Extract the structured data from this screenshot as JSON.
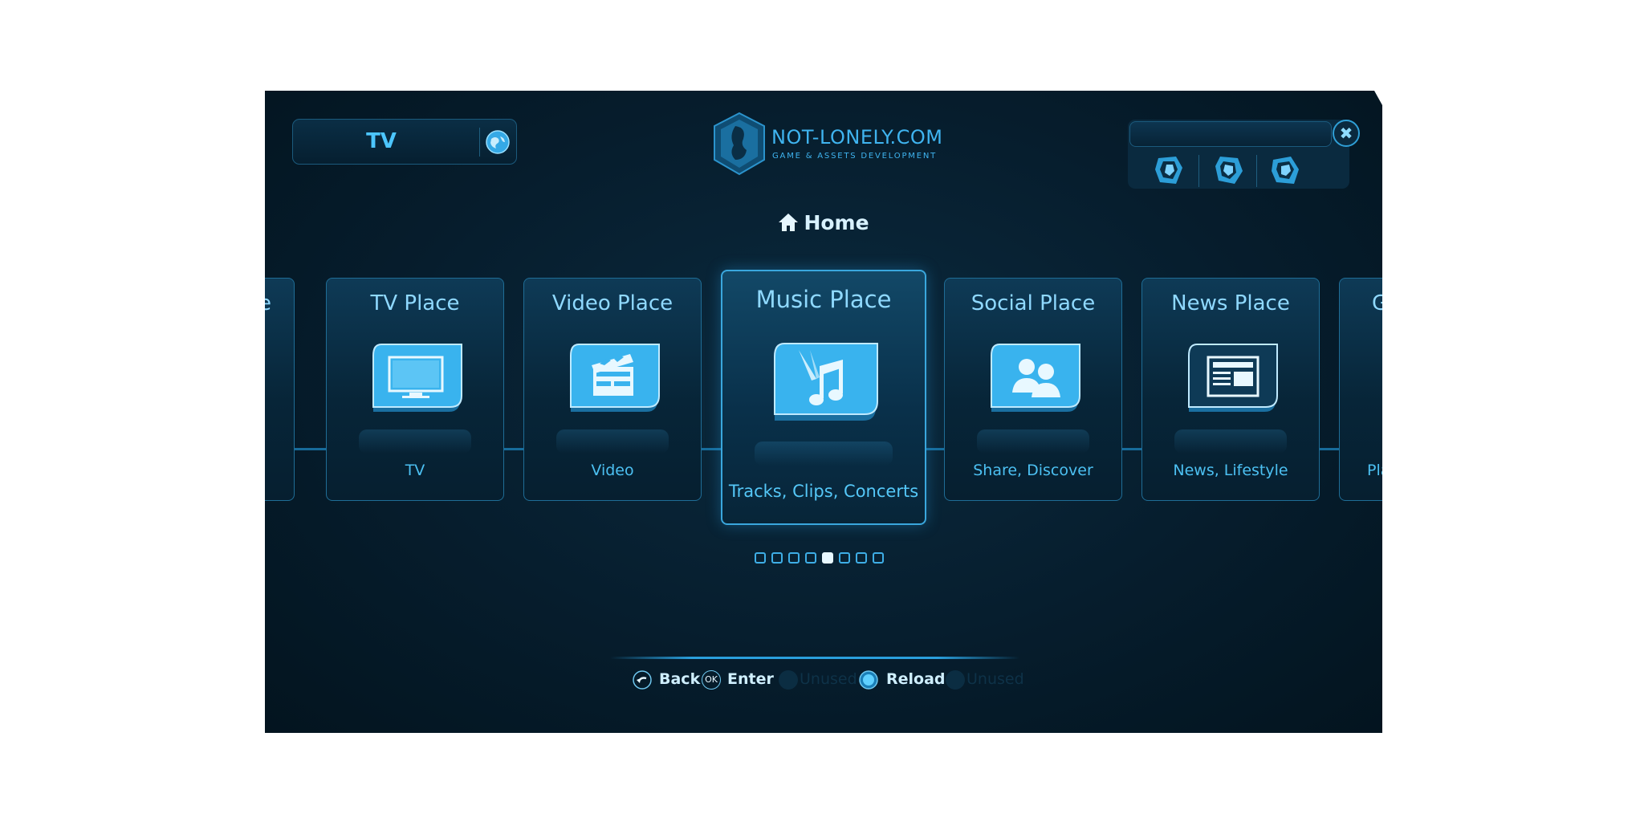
{
  "header": {
    "channel_label": "TV",
    "logo_title": "NOT-LONELY.COM",
    "logo_subtitle": "GAME & ASSETS DEVELOPMENT",
    "close_symbol": "✖"
  },
  "nav": {
    "home_label": "Home"
  },
  "carousel": {
    "cards": [
      {
        "title": "te",
        "subtitle": "",
        "icon": "partial-icon"
      },
      {
        "title": "TV Place",
        "subtitle": "TV",
        "icon": "tv-icon"
      },
      {
        "title": "Video Place",
        "subtitle": "Video",
        "icon": "clapperboard-icon"
      },
      {
        "title": "Music Place",
        "subtitle": "Tracks, Clips, Concerts",
        "icon": "music-note-icon",
        "active": true
      },
      {
        "title": "Social Place",
        "subtitle": "Share, Discover",
        "icon": "people-icon"
      },
      {
        "title": "News Place",
        "subtitle": "News, Lifestyle",
        "icon": "newspaper-icon"
      },
      {
        "title": "Ga",
        "subtitle": "Pla",
        "icon": "partial-icon"
      }
    ],
    "page_count": 8,
    "current_page": 5
  },
  "footer": {
    "back_label": "Back",
    "ok_label": "OK",
    "enter_label": "Enter",
    "unused_label_1": "Unused",
    "reload_label": "Reload",
    "unused_label_2": "Unused"
  },
  "colors": {
    "accent": "#3aa7dd",
    "text_light": "#8fd9ff",
    "background": "#061d2d"
  }
}
